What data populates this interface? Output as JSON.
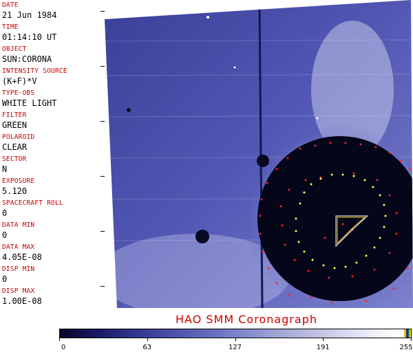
{
  "header": {
    "fields": [
      {
        "label": "DATE",
        "value": "21 Jun 1984"
      },
      {
        "label": "TIME",
        "value": "01:14:10 UT"
      },
      {
        "label": "OBJECT",
        "value": "SUN:CORONA"
      },
      {
        "label": "INTENSITY SOURCE",
        "value": "(K+F)*V"
      },
      {
        "label": "TYPE-OBS",
        "value": "WHITE LIGHT"
      },
      {
        "label": "FILTER",
        "value": "GREEN"
      },
      {
        "label": "POLAROID",
        "value": "CLEAR"
      },
      {
        "label": "SECTOR",
        "value": "N"
      },
      {
        "label": "EXPOSURE",
        "value": "5.120"
      },
      {
        "label": "SPACECRAFT ROLL",
        "value": "0"
      },
      {
        "label": "DATA MIN",
        "value": "0"
      },
      {
        "label": "DATA MAX",
        "value": "4.05E-08"
      },
      {
        "label": "DISP MIN",
        "value": "0"
      },
      {
        "label": "DISP MAX",
        "value": "1.00E-08"
      }
    ]
  },
  "title": "HAO  SMM Coronagraph",
  "colorbar": {
    "ticks": [
      "0",
      "63",
      "127",
      "191",
      "255"
    ]
  },
  "colors": {
    "label": "#cc0000",
    "marker": "#ff2020",
    "ring_marker": "#ffff40",
    "sky": "#4a4fae"
  }
}
